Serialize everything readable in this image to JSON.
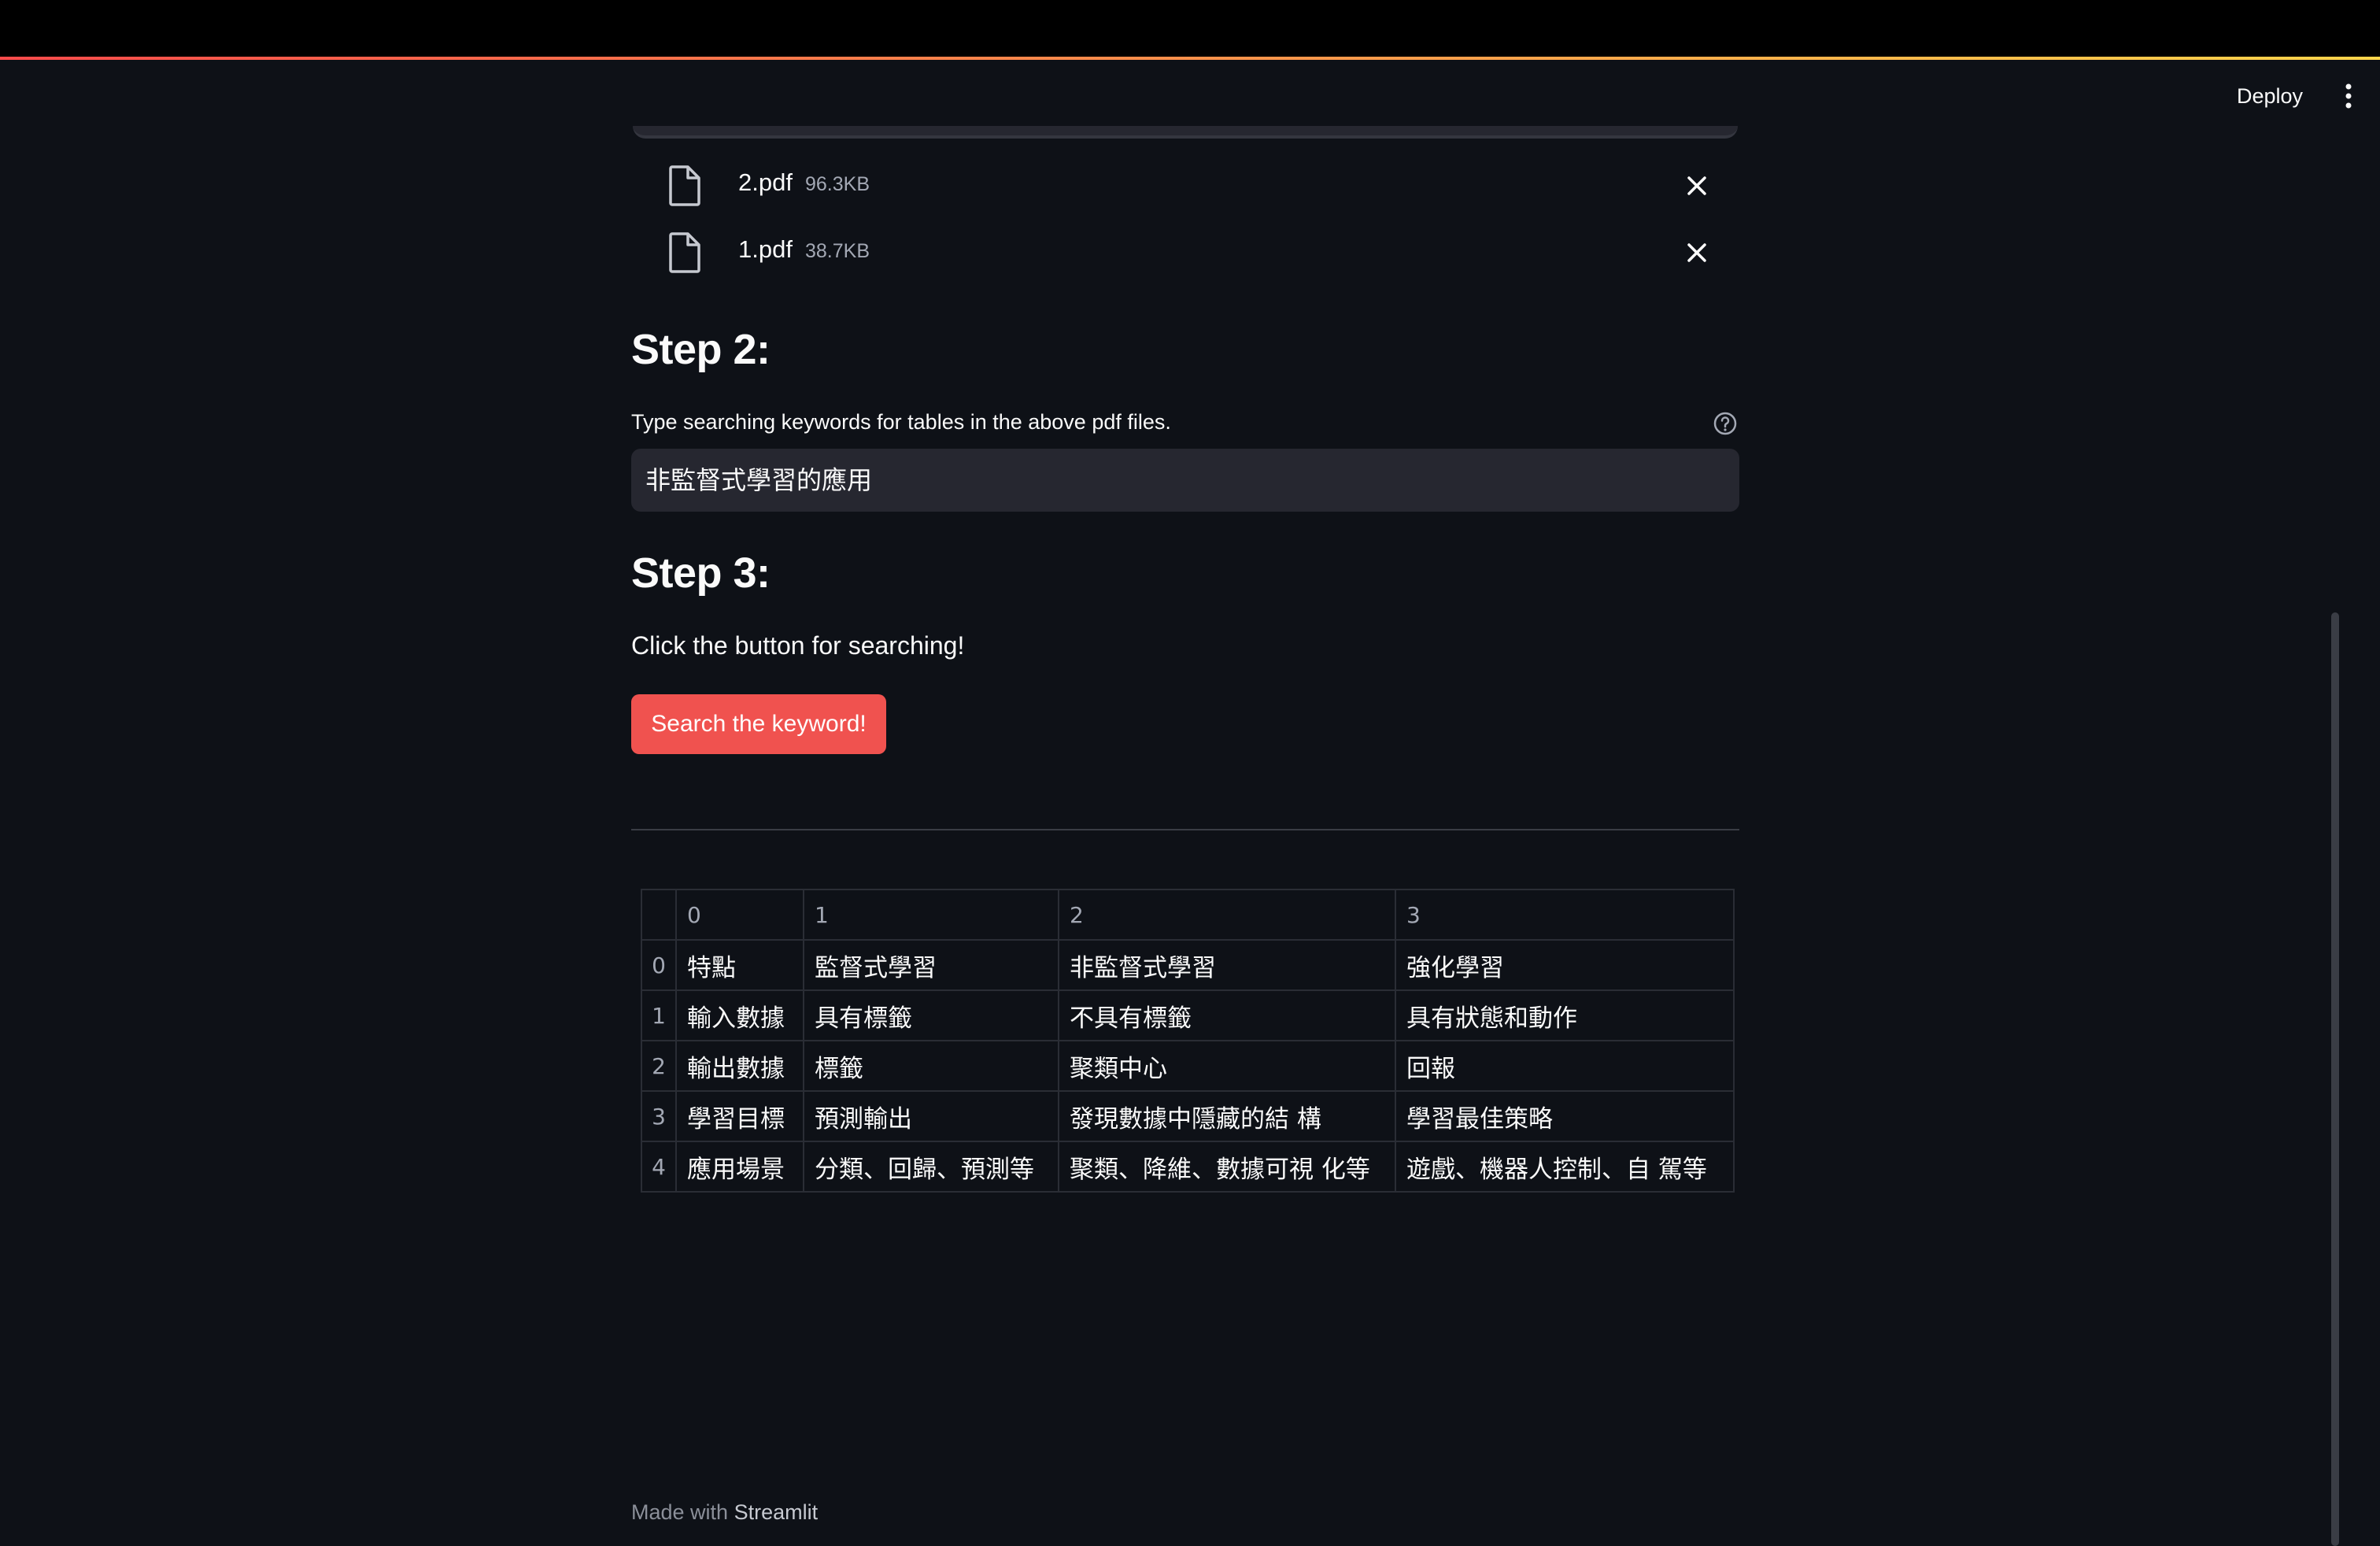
{
  "header": {
    "deploy_label": "Deploy",
    "menu_icon": "kebab-menu-icon"
  },
  "files": [
    {
      "name": "2.pdf",
      "size": "96.3KB",
      "icon": "file-icon",
      "remove_icon": "close-icon"
    },
    {
      "name": "1.pdf",
      "size": "38.7KB",
      "icon": "file-icon",
      "remove_icon": "close-icon"
    }
  ],
  "step2": {
    "heading": "Step 2:",
    "input_label": "Type searching keywords for tables in the above pdf files.",
    "input_value": "非監督式學習的應用",
    "help_icon": "question-circle-icon"
  },
  "step3": {
    "heading": "Step 3:",
    "instruction": "Click the button for searching!",
    "button_label": "Search the keyword!"
  },
  "result_table": {
    "columns": [
      "0",
      "1",
      "2",
      "3"
    ],
    "rows": [
      {
        "index": "0",
        "cells": [
          "特點",
          "監督式學習",
          "非監督式學習",
          "強化學習"
        ]
      },
      {
        "index": "1",
        "cells": [
          "輸入數據",
          "具有標籤",
          "不具有標籤",
          "具有狀態和動作"
        ]
      },
      {
        "index": "2",
        "cells": [
          "輸出數據",
          "標籤",
          "聚類中心",
          "回報"
        ]
      },
      {
        "index": "3",
        "cells": [
          "學習目標",
          "預測輸出",
          "發現數據中隱藏的結 構",
          "學習最佳策略"
        ]
      },
      {
        "index": "4",
        "cells": [
          "應用場景",
          "分類、回歸、預測等",
          "聚類、降維、數據可視 化等",
          "遊戲、機器人控制、自 駕等"
        ]
      }
    ]
  },
  "footer": {
    "made_with": "Made with",
    "brand": "Streamlit"
  },
  "colors": {
    "background": "#0e1117",
    "primary_button": "#f0524f",
    "input_background": "#262730",
    "text": "#fafafa"
  }
}
